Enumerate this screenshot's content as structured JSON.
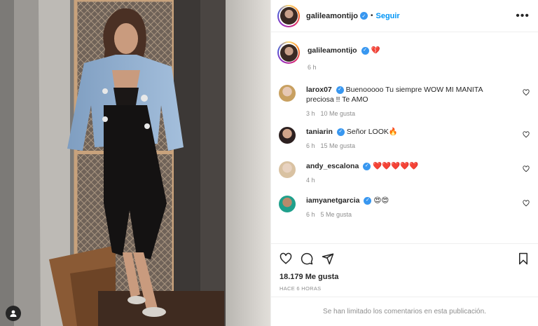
{
  "post": {
    "username": "galileamontijo",
    "follow_label": "Seguir",
    "separator": "•",
    "more_label": "•••",
    "caption_emoji": "💔",
    "caption_time": "6 h",
    "likes": "18.179 Me gusta",
    "posted_ago": "HACE 6 HORAS",
    "comments_limited": "Se han limitado los comentarios en esta publicación."
  },
  "comments": [
    {
      "user": "larox07",
      "text": "Buenooooo Tu siempre WOW MI MANITA preciosa !! Te AMO",
      "time": "3 h",
      "likes": "10 Me gusta"
    },
    {
      "user": "taniarin",
      "text": "Señor LOOK🔥",
      "time": "6 h",
      "likes": "15 Me gusta"
    },
    {
      "user": "andy_escalona",
      "text": "❤️❤️❤️❤️❤️",
      "time": "4 h",
      "likes": ""
    },
    {
      "user": "iamyanetgarcia",
      "text": "😍😍",
      "time": "6 h",
      "likes": "5 Me gusta"
    }
  ],
  "icons": {
    "verified": "verified-badge-icon",
    "like": "heart-icon",
    "comment": "comment-icon",
    "share": "share-icon",
    "save": "bookmark-icon",
    "tags": "user-tag-icon"
  },
  "colors": {
    "accent": "#0095f6",
    "verified": "#3897f0",
    "muted": "#8e8e8e"
  }
}
